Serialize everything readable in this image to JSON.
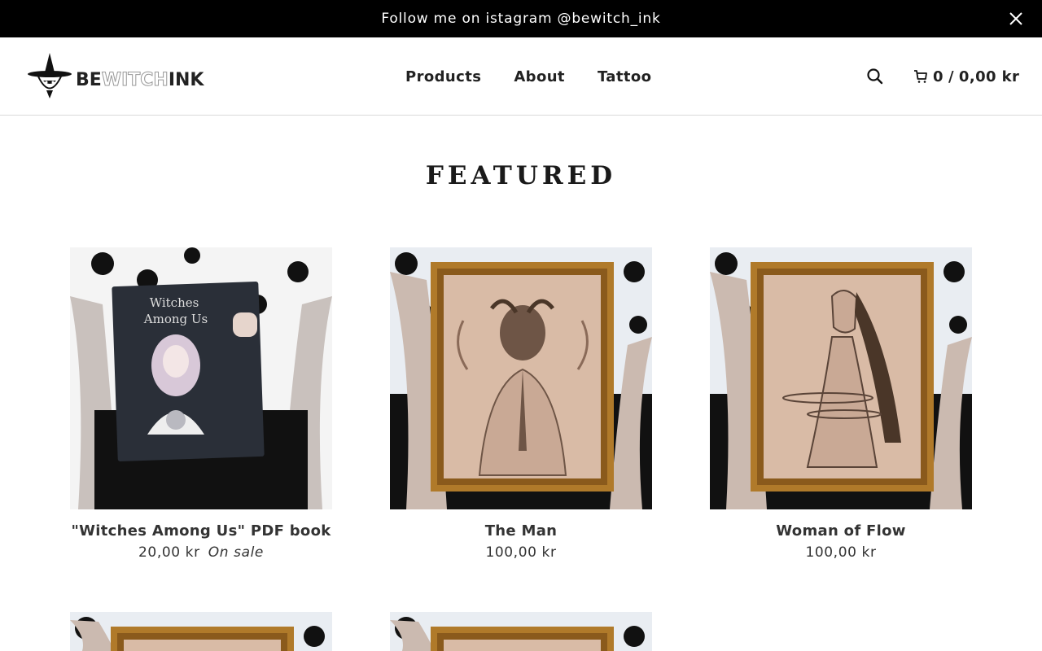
{
  "announcement": {
    "text": "Follow me on istagram @bewitch_ink"
  },
  "header": {
    "logo": {
      "part1": "BE",
      "part2": "WITCH",
      "part3": "INK"
    },
    "nav": [
      "Products",
      "About",
      "Tattoo"
    ],
    "cart": {
      "count": "0",
      "separator": "/",
      "total": "0,00 kr"
    }
  },
  "section": {
    "title": "FEATURED"
  },
  "products": [
    {
      "name": "\"Witches Among Us\" PDF book",
      "price": "20,00 kr",
      "badge": "On sale",
      "book_title_1": "Witches",
      "book_title_2": "Among Us"
    },
    {
      "name": "The Man",
      "price": "100,00 kr"
    },
    {
      "name": "Woman of Flow",
      "price": "100,00 kr"
    }
  ],
  "colors": {
    "bar": "#000000",
    "text": "#222222",
    "frame": "#b07a2a",
    "art": "#d9bba6"
  },
  "icons": {
    "close": "close-icon",
    "search": "search-icon",
    "cart": "cart-icon"
  }
}
